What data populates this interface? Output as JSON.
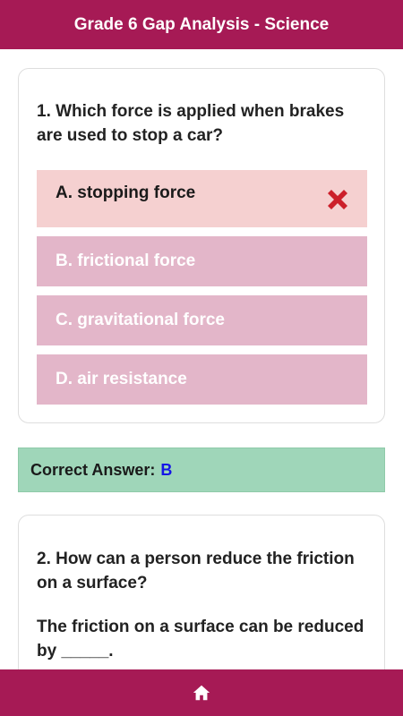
{
  "header": {
    "title": "Grade 6 Gap Analysis - Science"
  },
  "questions": [
    {
      "text": "1. Which force is applied when brakes are used to stop a car?",
      "options": [
        {
          "label": "A. stopping force",
          "state": "selected-wrong"
        },
        {
          "label": "B. frictional force",
          "state": "unselected"
        },
        {
          "label": "C. gravitational force",
          "state": "unselected"
        },
        {
          "label": "D. air resistance",
          "state": "unselected"
        }
      ],
      "wrong_icon": "close-x-icon",
      "correct_answer_label": "Correct Answer:",
      "correct_answer_value": "B"
    },
    {
      "text": "2. How can a person reduce the friction on a surface?",
      "prompt": "The friction on a surface can be reduced by _____."
    }
  ],
  "footer": {
    "icon": "home-icon"
  },
  "colors": {
    "brand": "#a61a55",
    "option_bg": "#e3b6c9",
    "wrong_bg": "#f5d0d0",
    "wrong_mark": "#cc1f2a",
    "correct_bg": "#9fd6b9",
    "answer_value": "#1515e6"
  }
}
